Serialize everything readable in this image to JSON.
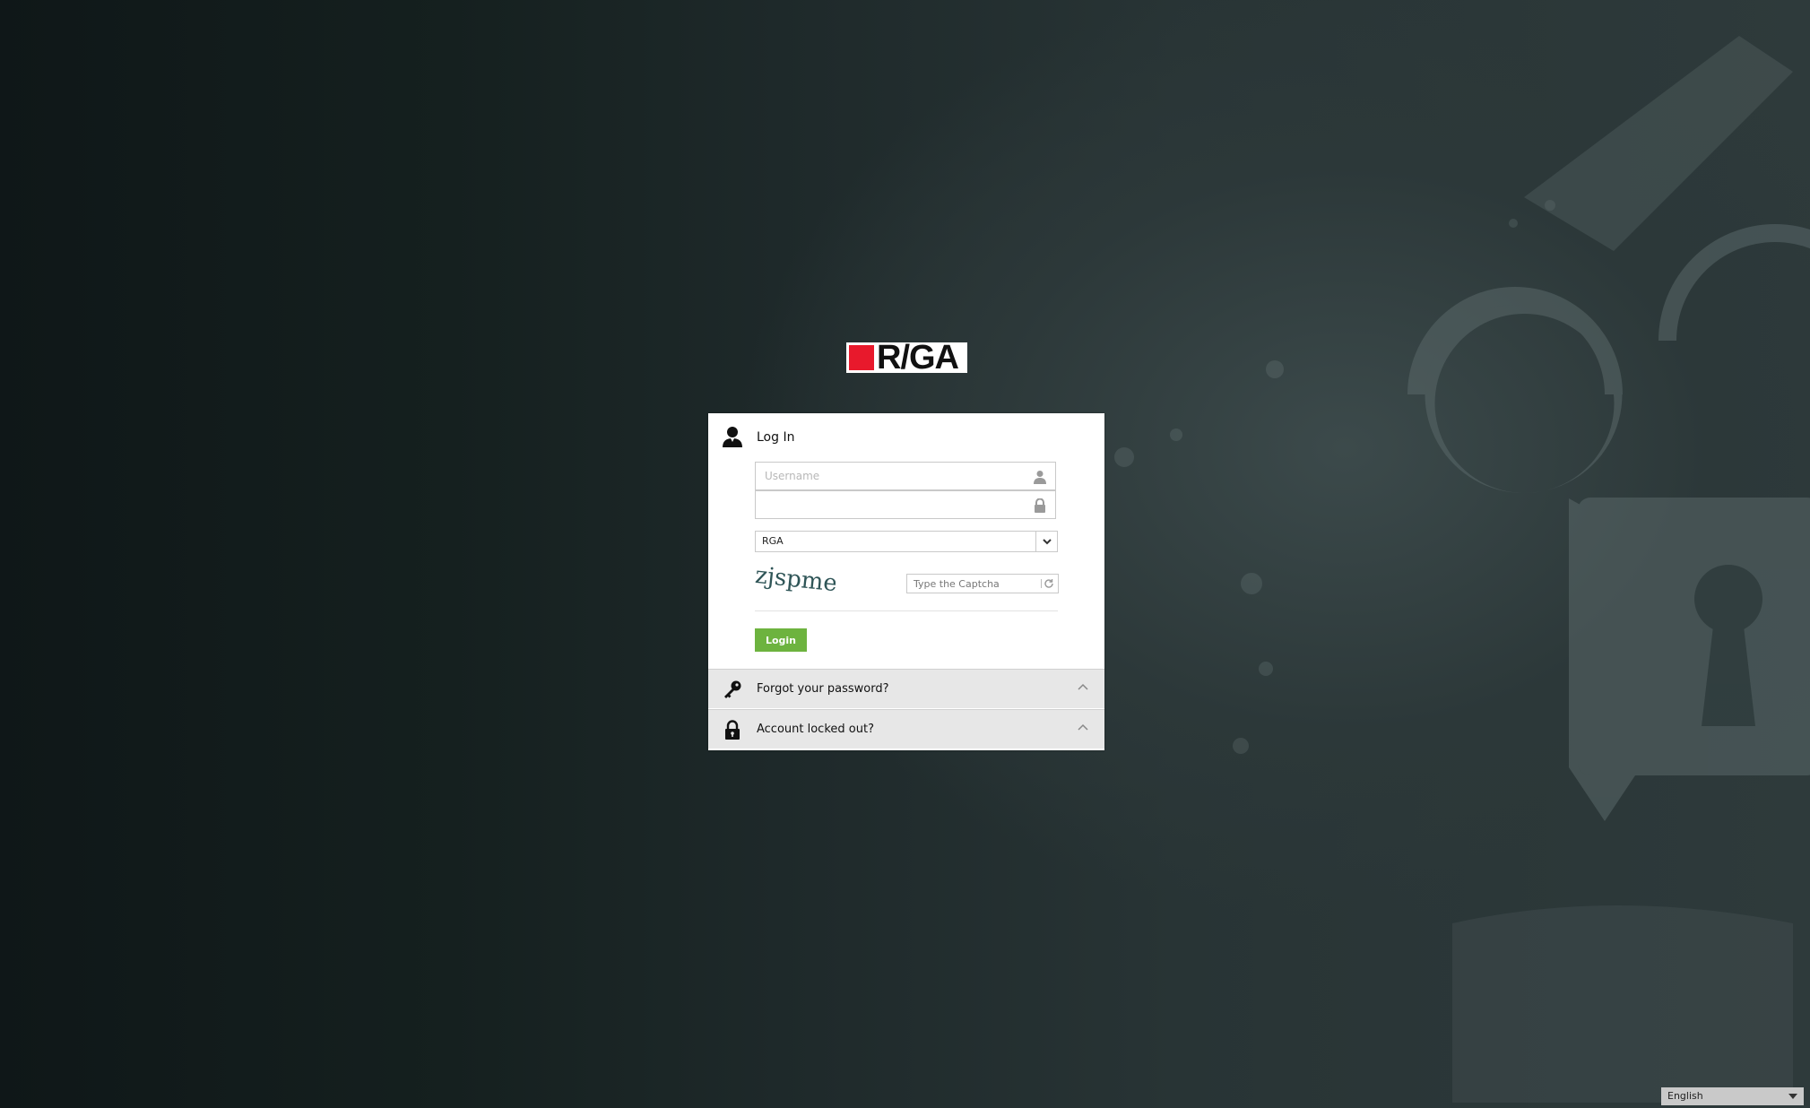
{
  "brand": {
    "logo_text": "R/GA",
    "accent": "#e8192c"
  },
  "login": {
    "title": "Log In",
    "username_placeholder": "Username",
    "username_value": "",
    "password_value": "",
    "domain_selected": "RGA",
    "captcha_text": "zjspme",
    "captcha_placeholder": "Type the Captcha",
    "login_label": "Login",
    "button_color": "#6db33f"
  },
  "accordion": {
    "forgot_label": "Forgot your password?",
    "locked_label": "Account locked out?"
  },
  "footer": {
    "language": "English"
  },
  "icons": {
    "header": "user-icon",
    "username": "user-icon",
    "password": "lock-icon",
    "forgot": "key-icon",
    "locked": "padlock-icon",
    "refresh": "refresh-icon"
  }
}
